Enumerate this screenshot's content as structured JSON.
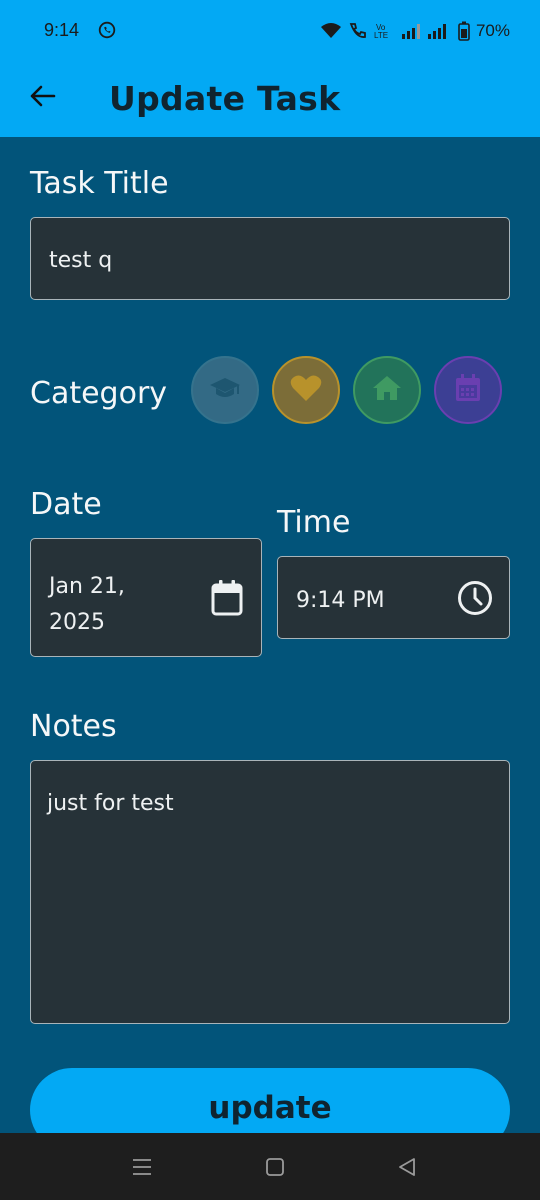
{
  "status_bar": {
    "time": "9:14",
    "battery": "70%",
    "icons": [
      "whatsapp-icon",
      "wifi-icon",
      "call-icon",
      "volte-icon",
      "signal-icon",
      "battery-icon"
    ]
  },
  "app_bar": {
    "title": "Update Task",
    "back_icon": "arrow-left-icon"
  },
  "task_title": {
    "label": "Task Title",
    "value": "test q"
  },
  "category": {
    "label": "Category",
    "options": [
      {
        "name": "education",
        "icon": "graduation-cap-icon",
        "color": "#4f7e93"
      },
      {
        "name": "health",
        "icon": "heart-icon",
        "color": "#b8922b"
      },
      {
        "name": "home",
        "icon": "home-icon",
        "color": "#3f9a62"
      },
      {
        "name": "calendar",
        "icon": "calendar-icon",
        "color": "#6a3fb0"
      }
    ]
  },
  "date": {
    "label": "Date",
    "value_line1": "Jan 21,",
    "value_line2": "2025",
    "icon": "calendar-icon"
  },
  "time": {
    "label": "Time",
    "value": "9:14 PM",
    "icon": "clock-icon"
  },
  "notes": {
    "label": "Notes",
    "value": "just for test"
  },
  "actions": {
    "update_label": "update",
    "update_color": "#03a9f4"
  },
  "colors": {
    "background": "#02547a",
    "app_bar": "#03a9f4",
    "field_background": "#263238"
  },
  "nav_bar": {
    "items": [
      "recents-icon",
      "home-icon",
      "back-icon"
    ]
  }
}
